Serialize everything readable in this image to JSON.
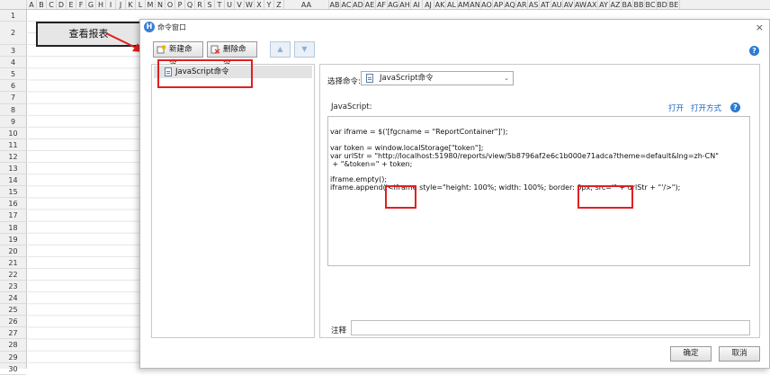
{
  "spreadsheet": {
    "columns": [
      "A",
      "B",
      "C",
      "D",
      "E",
      "F",
      "G",
      "H",
      "I",
      "J",
      "K",
      "L",
      "M",
      "N",
      "O",
      "P",
      "Q",
      "R",
      "S",
      "T",
      "U",
      "V",
      "W",
      "X",
      "Y",
      "Z",
      "AA",
      "AB",
      "AC",
      "AD",
      "AE",
      "AF",
      "AG",
      "AH",
      "AI",
      "AJ",
      "AK",
      "AL",
      "AM",
      "AN",
      "AO",
      "AP",
      "AQ",
      "AR",
      "AS",
      "AT",
      "AU",
      "AV",
      "AW",
      "AX",
      "AY",
      "AZ",
      "BA",
      "BB",
      "BC",
      "BD",
      "BE"
    ],
    "rows": [
      "1",
      "2",
      "3",
      "4",
      "5",
      "6",
      "7",
      "8",
      "9",
      "10",
      "11",
      "12",
      "13",
      "14",
      "15",
      "16",
      "17",
      "18",
      "19",
      "20",
      "21",
      "22",
      "23",
      "24",
      "25",
      "26",
      "27",
      "28",
      "29",
      "30"
    ],
    "cell_button_label": "查看报表"
  },
  "dialog": {
    "title": "命令窗口",
    "app_icon": "H",
    "close_icon": "×",
    "toolbar": {
      "new_label": "新建命令",
      "delete_label": "删除命令",
      "up_icon": "▲",
      "down_icon": "▼"
    },
    "help_icon": "?",
    "tree": {
      "items": [
        {
          "label": "JavaScript命令"
        }
      ]
    },
    "select": {
      "label": "选择命令:",
      "value": "JavaScript命令",
      "chevron": "⌄"
    },
    "js_label": "JavaScript:",
    "links": {
      "open": "打开",
      "open_with": "打开方式"
    },
    "code": "var iframe = $('[fgcname = \"ReportContainer\"]');\n\nvar token = window.localStorage[\"token\"];\nvar urlStr = \"http://localhost:51980/reports/view/5b8796af2e6c1b000e71adca?theme=default&lng=zh-CN\"\n + \"&token=\" + token;\n\niframe.empty();\niframe.append('<iframe style=\"height: 100%; width: 100%; border: 0px; src='\" + urlStr + \"'/>\");",
    "note_label": "注释",
    "ok_label": "确定",
    "cancel_label": "取消"
  },
  "colors": {
    "highlight": "#e02020",
    "link": "#1a63c6",
    "accent": "#2b7cd3"
  }
}
